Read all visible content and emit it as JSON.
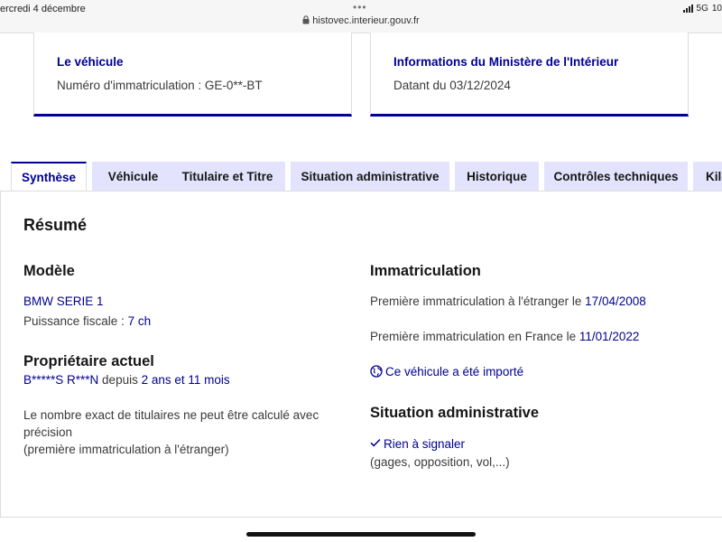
{
  "status": {
    "time": "ercredi 4 décembre",
    "url": "histovec.interieur.gouv.fr",
    "network": "5G",
    "battery": "10"
  },
  "cards": {
    "vehicle": {
      "title": "Le véhicule",
      "label": "Numéro d'immatriculation : ",
      "value": "GE-0**-BT"
    },
    "ministry": {
      "title": "Informations du Ministère de l'Intérieur",
      "label": "Datant du ",
      "value": "03/12/2024"
    }
  },
  "tabs": [
    {
      "label": "Synthèse",
      "active": true
    },
    {
      "label": "Véhicule"
    },
    {
      "label": "Titulaire et Titre"
    },
    {
      "label": "Situation administrative"
    },
    {
      "label": "Historique"
    },
    {
      "label": "Contrôles techniques"
    },
    {
      "label": "Kilo"
    }
  ],
  "summary": {
    "title": "Résumé",
    "model": {
      "heading": "Modèle",
      "name": "BMW SERIE 1",
      "power_label": "Puissance fiscale : ",
      "power_value": "7 ch"
    },
    "owner": {
      "heading": "Propriétaire actuel",
      "name": "B*****S R***N",
      "since_label": " depuis ",
      "since_value": "2 ans et 11 mois",
      "note_line1": "Le nombre exact de titulaires ne peut être calculé avec",
      "note_line2": "précision",
      "note_line3": "(première immatriculation à l'étranger)"
    },
    "registration": {
      "heading": "Immatriculation",
      "foreign_label": "Première immatriculation à l'étranger le ",
      "foreign_date": "17/04/2008",
      "france_label": "Première immatriculation en France le ",
      "france_date": "11/01/2022",
      "imported": "Ce véhicule a été importé"
    },
    "admin": {
      "heading": "Situation administrative",
      "status": "Rien à signaler",
      "details": "(gages, opposition, vol,...)"
    }
  },
  "colors": {
    "accent": "#000091",
    "tab_background": "#e3e3fd"
  }
}
